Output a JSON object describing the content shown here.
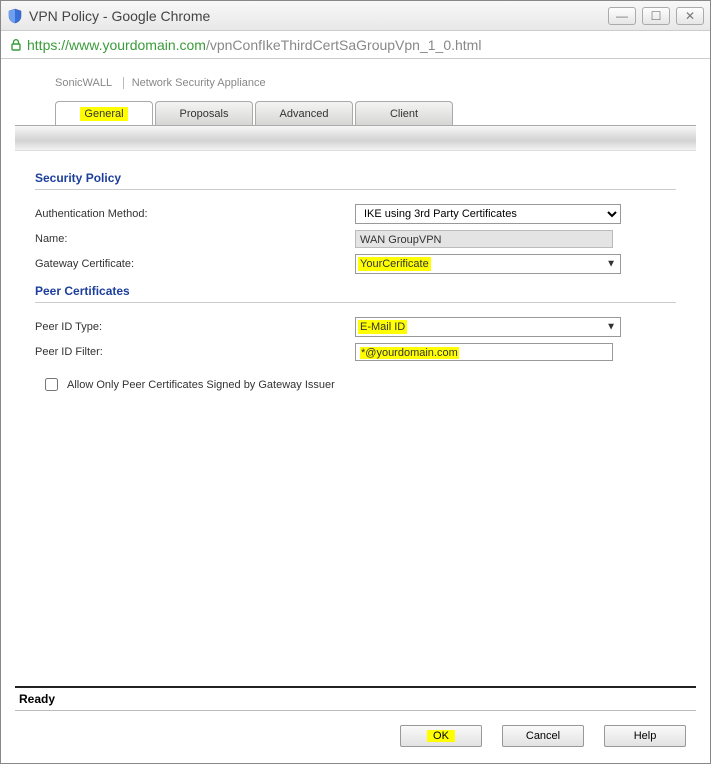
{
  "window": {
    "title": "VPN Policy - Google Chrome"
  },
  "url": {
    "scheme_domain": "https://www.yourdomain.com",
    "path": "/vpnConfIkeThirdCertSaGroupVpn_1_0.html"
  },
  "breadcrumb": {
    "brand": "SonicWALL",
    "product": "Network Security Appliance"
  },
  "tabs": {
    "general": "General",
    "proposals": "Proposals",
    "advanced": "Advanced",
    "client": "Client"
  },
  "sections": {
    "security_policy": "Security Policy",
    "peer_certificates": "Peer Certificates"
  },
  "fields": {
    "auth_method_label": "Authentication Method:",
    "auth_method_value": "IKE using 3rd Party Certificates",
    "name_label": "Name:",
    "name_value": "WAN GroupVPN",
    "gateway_cert_label": "Gateway Certificate:",
    "gateway_cert_value": "YourCerificate",
    "peer_id_type_label": "Peer ID Type:",
    "peer_id_type_value": "E-Mail ID",
    "peer_id_filter_label": "Peer ID Filter:",
    "peer_id_filter_value": "*@yourdomain.com",
    "allow_only_label": "Allow Only Peer Certificates Signed by Gateway Issuer"
  },
  "status": "Ready",
  "buttons": {
    "ok": "OK",
    "cancel": "Cancel",
    "help": "Help"
  }
}
